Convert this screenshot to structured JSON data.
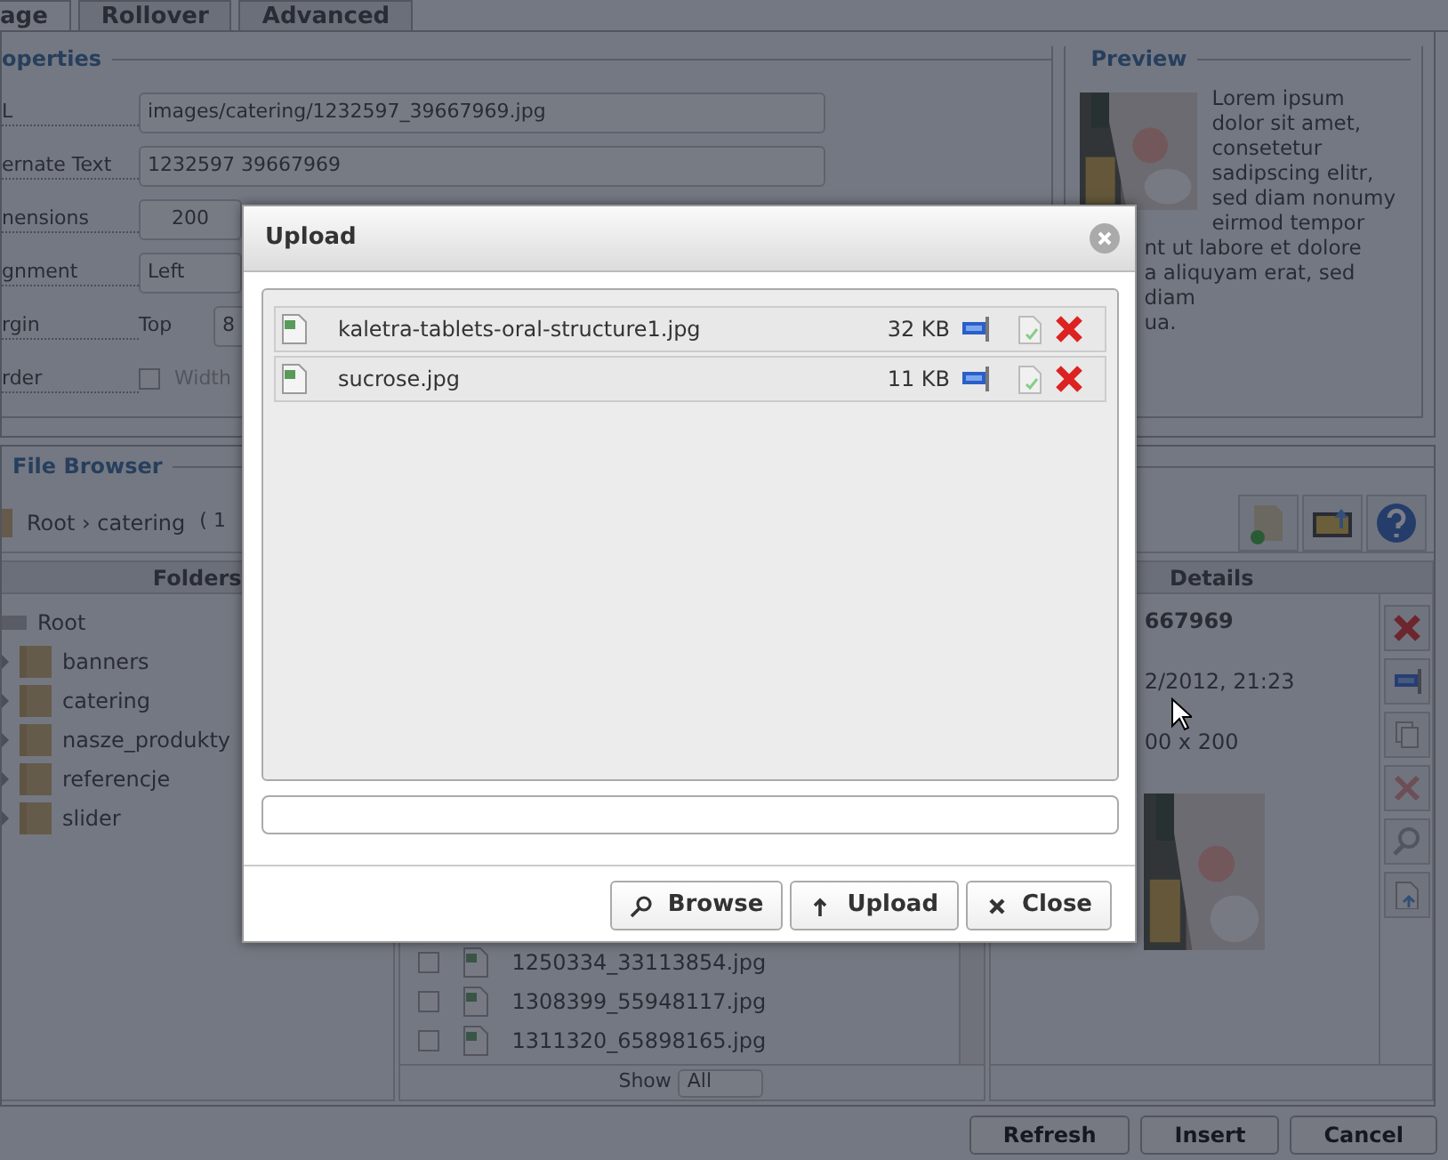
{
  "tabs": [
    {
      "label": "age",
      "selected": true
    },
    {
      "label": "Rollover",
      "selected": false
    },
    {
      "label": "Advanced",
      "selected": false
    }
  ],
  "properties": {
    "legend": "operties",
    "rows": [
      {
        "kind": "text",
        "label": "L",
        "value": "images/catering/1232597_39667969.jpg"
      },
      {
        "kind": "text",
        "label": "ernate Text",
        "value": "1232597 39667969"
      },
      {
        "kind": "dimensions",
        "label": "nensions",
        "value": "200"
      },
      {
        "kind": "select",
        "label": "gnment",
        "value": "Left"
      },
      {
        "kind": "margin",
        "label": "rgin",
        "sub_label": "Top",
        "value": "8"
      },
      {
        "kind": "border",
        "label": "rder",
        "checked": false,
        "sub_label": "Width"
      }
    ]
  },
  "preview": {
    "legend": "Preview",
    "lines": [
      "Lorem ipsum",
      "dolor sit amet,",
      "consetetur",
      "sadipscing elitr,",
      "sed diam nonumy",
      "eirmod tempor"
    ],
    "covered_lines": [
      "nt ut labore et dolore",
      "a aliquyam erat, sed diam",
      "ua."
    ]
  },
  "file_browser": {
    "legend": "File Browser",
    "breadcrumb": "Root › catering",
    "count": "( 1",
    "folders": {
      "header": "Folders",
      "root": "Root",
      "children": [
        {
          "label": "banners"
        },
        {
          "label": "catering"
        },
        {
          "label": "nasze_produkty"
        },
        {
          "label": "referencje"
        },
        {
          "label": "slider"
        }
      ]
    },
    "files": [
      {
        "name": "1250334_33113854.jpg",
        "checked": false
      },
      {
        "name": "1308399_55948117.jpg",
        "checked": false
      },
      {
        "name": "1311320_65898165.jpg",
        "checked": false
      }
    ],
    "show_label": "Show",
    "show_value": "All",
    "details": {
      "header": "Details",
      "name": "667969",
      "lines": [
        "2/2012, 21:23",
        "00 x 200"
      ]
    }
  },
  "footer_buttons": [
    "Refresh",
    "Insert",
    "Cancel"
  ],
  "upload": {
    "title": "Upload",
    "files": [
      {
        "name": "kaletra-tablets-oral-structure1.jpg",
        "size": "32 KB"
      },
      {
        "name": "sucrose.jpg",
        "size": "11 KB"
      }
    ],
    "buttons": [
      {
        "kind": "browse",
        "label": "Browse"
      },
      {
        "kind": "upload",
        "label": "Upload"
      },
      {
        "kind": "close",
        "label": "Close"
      }
    ]
  }
}
